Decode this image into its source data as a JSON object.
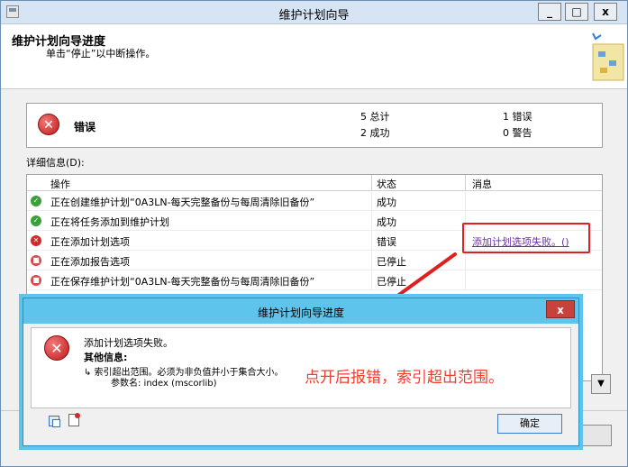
{
  "main_window": {
    "title": "维护计划向导",
    "controls": {
      "minimize": "_",
      "maximize": "□",
      "close": "x"
    }
  },
  "header": {
    "title": "维护计划向导进度",
    "subtitle": "单击“停止”以中断操作。"
  },
  "summary": {
    "status": "错误",
    "counts": {
      "total": "5 总计",
      "success": "2 成功",
      "errors": "1 错误",
      "warnings": "0 警告"
    }
  },
  "details": {
    "label": "详细信息(D):",
    "columns": [
      "操作",
      "状态",
      "消息"
    ],
    "rows": [
      {
        "icon": "success-icon",
        "operation": "正在创建维护计划“0A3LN-每天完整备份与每周清除旧备份”",
        "status": "成功",
        "message": ""
      },
      {
        "icon": "success-icon",
        "operation": "正在将任务添加到维护计划",
        "status": "成功",
        "message": ""
      },
      {
        "icon": "error-icon",
        "operation": "正在添加计划选项",
        "status": "错误",
        "message": "添加计划选项失败。()"
      },
      {
        "icon": "stop-icon",
        "operation": "正在添加报告选项",
        "status": "已停止",
        "message": ""
      },
      {
        "icon": "stop-icon",
        "operation": "正在保存维护计划“0A3LN-每天完整备份与每周清除旧备份”",
        "status": "已停止",
        "message": ""
      }
    ]
  },
  "dialog": {
    "title": "维护计划向导进度",
    "close": "x",
    "message": "添加计划选项失败。",
    "extra_label": "其他信息:",
    "extra_line": "↳  索引超出范围。必须为非负值并小于集合大小。",
    "param_line": "参数名: index (mscorlib)",
    "ok_label": "确定",
    "annotation": "点开后报错，索引超出范围。"
  },
  "colors": {
    "highlight": "#e02020",
    "annotation": "#f23c2c",
    "dialog_frame": "#5fc4ec"
  }
}
